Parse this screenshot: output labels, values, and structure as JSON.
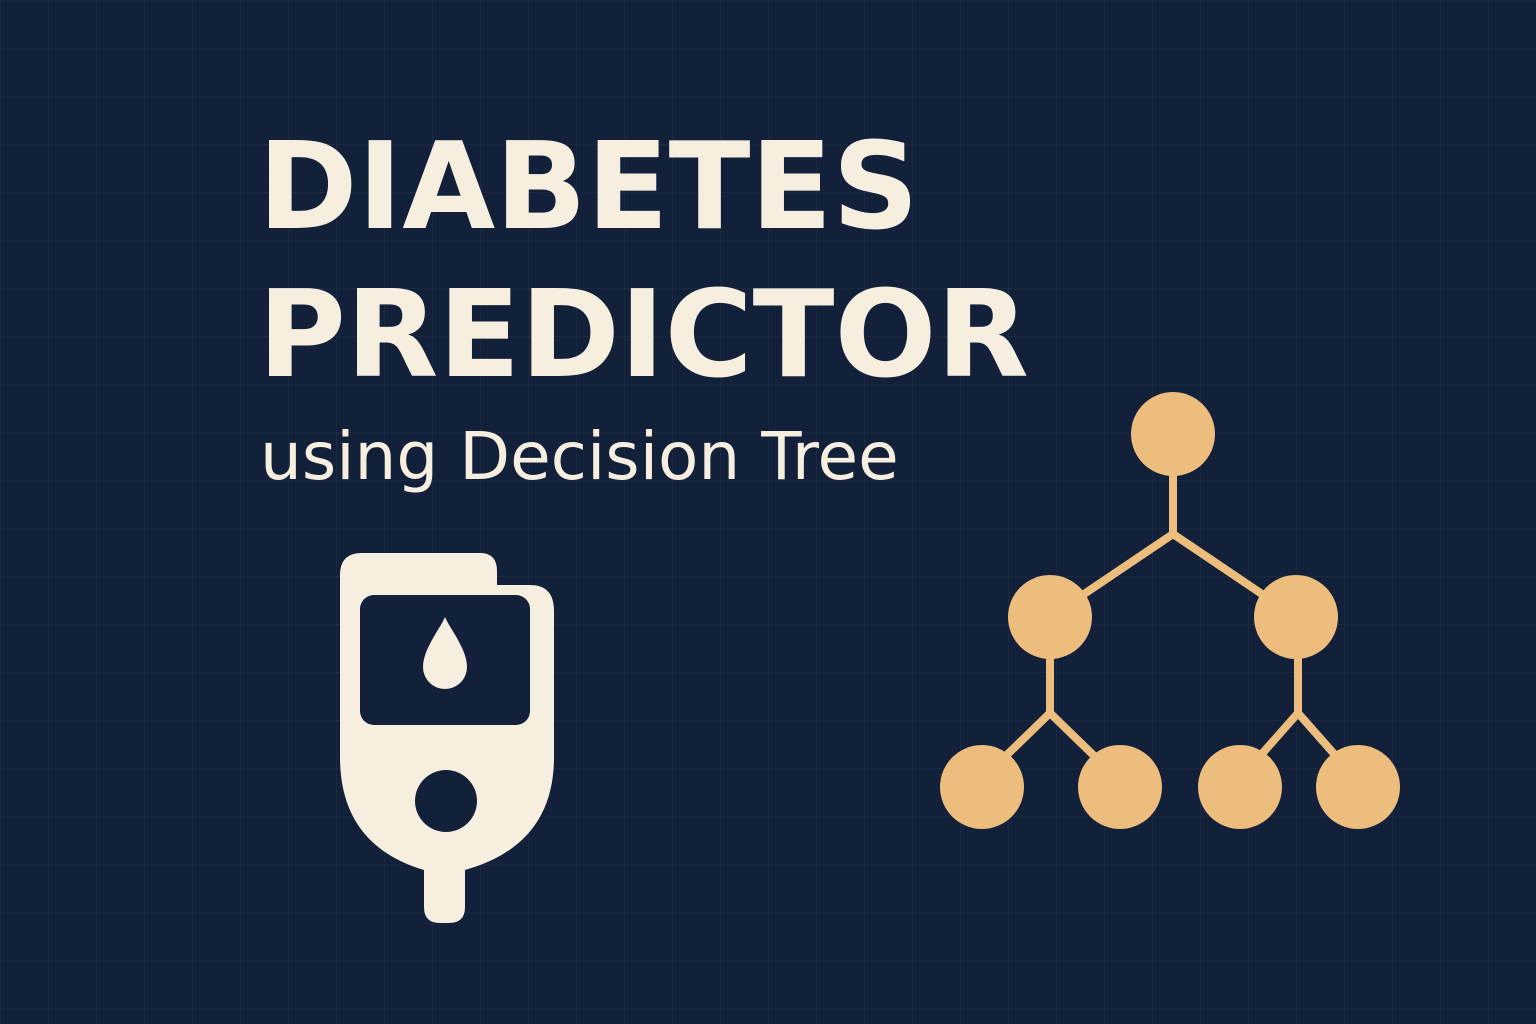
{
  "title": {
    "line1": "DIABETES",
    "line2": "PREDICTOR"
  },
  "subtitle": "using Decision Tree",
  "icons": {
    "left": "glucose-meter-icon",
    "right": "decision-tree-icon"
  },
  "colors": {
    "background": "#12203a",
    "text": "#f6efe0",
    "accent": "#ecbd7d"
  }
}
